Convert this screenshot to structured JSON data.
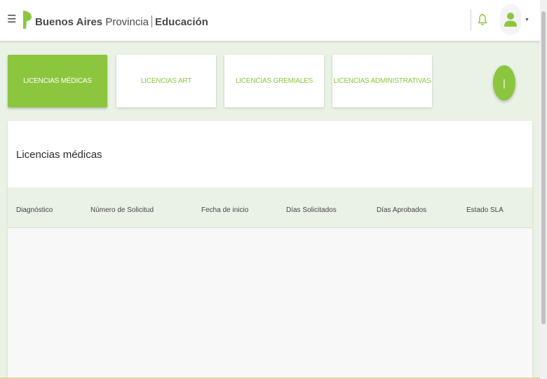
{
  "header": {
    "brand_part1": "Buenos Aires",
    "brand_part2": "Provincia",
    "brand_part3": "Educación",
    "colors": {
      "accent": "#8cc63f",
      "logo": "#8cc63f"
    }
  },
  "tabs": [
    {
      "label": "LICENCIAS MÉDICAS",
      "active": true
    },
    {
      "label": "LICENCIAS ART",
      "active": false
    },
    {
      "label": "LICENCIAS GREMIALES",
      "active": false
    },
    {
      "label": "LICENCIAS ADMINISTRATIVAS",
      "active": false
    }
  ],
  "fab": {
    "label": "|"
  },
  "main": {
    "title": "Licencias médicas",
    "columns": [
      "Diagnóstico",
      "Número de Solicitud",
      "Fecha de inicio",
      "Días Solicitados",
      "Días Aprobados",
      "Estado SLA"
    ],
    "rows": []
  },
  "icons": {
    "menu": "menu-icon",
    "logo": "province-logo-icon",
    "bell": "bell-icon",
    "user": "user-icon",
    "caret": "caret-down-icon"
  }
}
